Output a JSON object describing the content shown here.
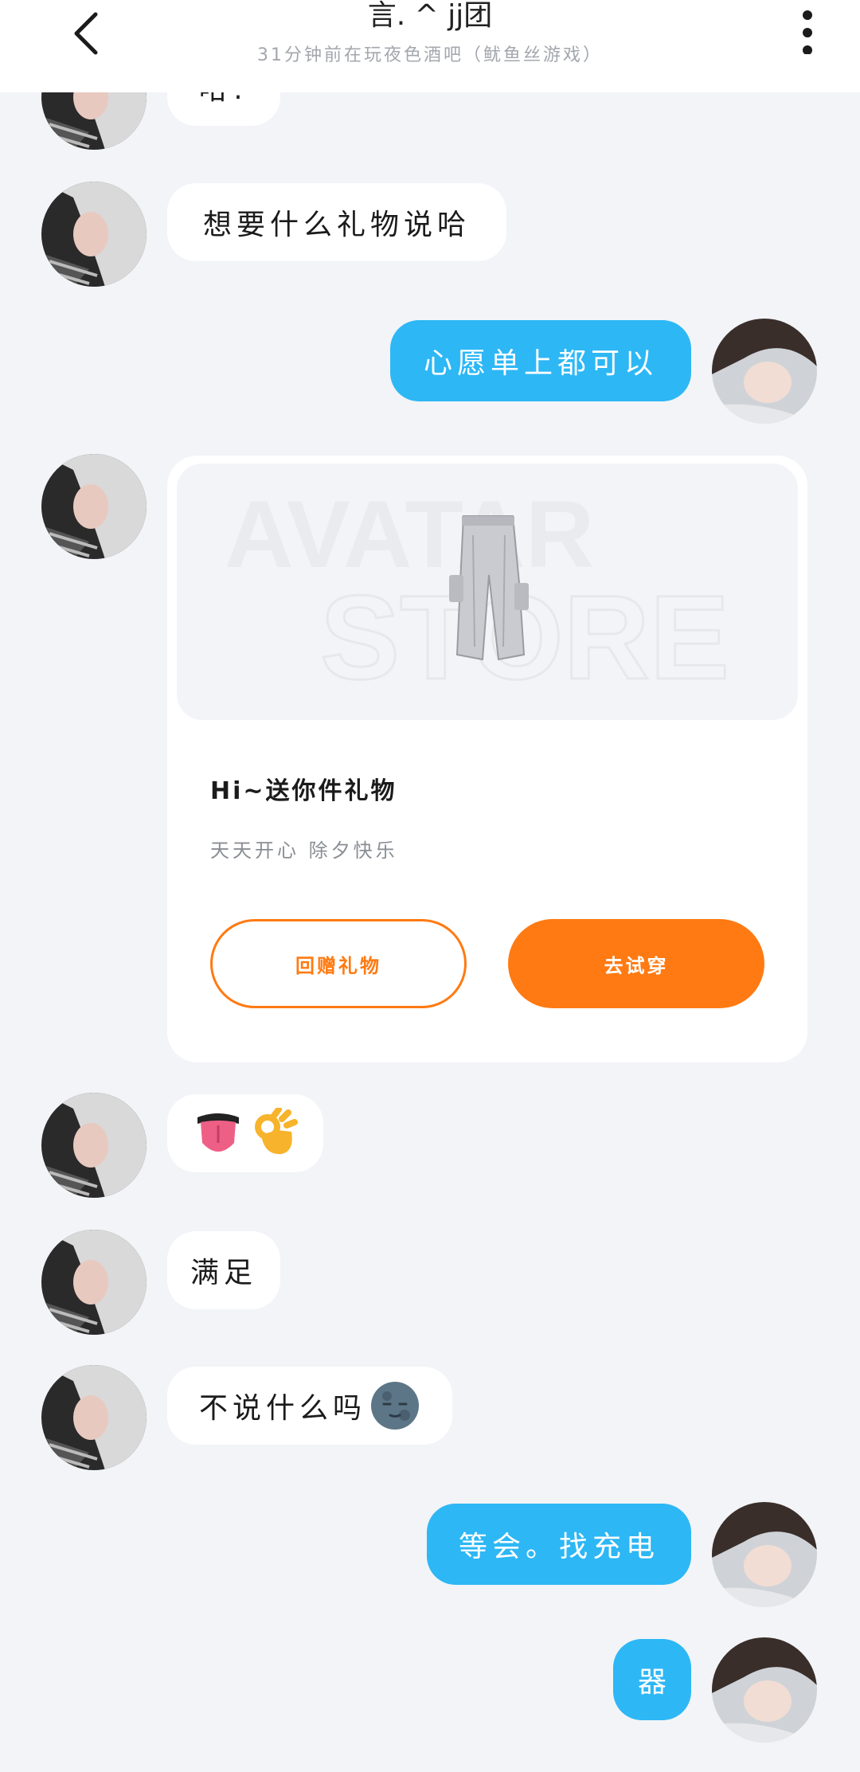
{
  "header": {
    "title": "言. ^ jj团",
    "subtitle": "31分钟前在玩夜色酒吧（鱿鱼丝游戏）"
  },
  "messages": {
    "m0": "哈!",
    "m1": "想要什么礼物说哈",
    "m2": "心愿单上都可以",
    "m4_emoji": "😛👌",
    "m5": "满足",
    "m6": "不说什么吗",
    "m7": "等会。找充电",
    "m8": "器"
  },
  "gift_card": {
    "watermark_line1": "AVATAR",
    "watermark_line2": "STORE",
    "title": "Hi~送你件礼物",
    "message": "天天开心  除夕快乐",
    "return_gift_label": "回赠礼物",
    "try_on_label": "去试穿"
  },
  "colors": {
    "outgoing_bubble": "#2db7f5",
    "accent_orange": "#ff7a12",
    "background": "#f2f4f7"
  }
}
